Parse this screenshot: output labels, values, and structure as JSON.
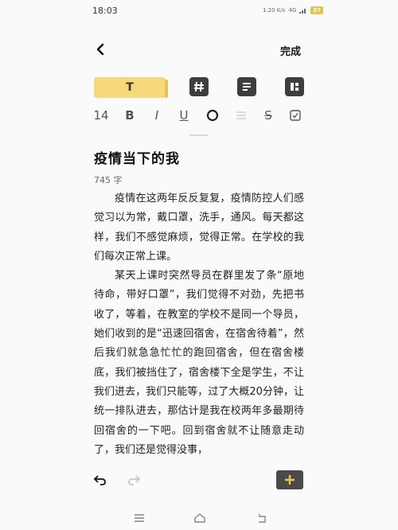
{
  "status": {
    "time": "18:03",
    "speed": "1.20 K/s",
    "network": "4G",
    "battery": "57"
  },
  "header": {
    "done_label": "完成"
  },
  "toolbar": {
    "text_style_label": "T",
    "tools": [
      "hash-icon",
      "list-icon",
      "layout-icon"
    ]
  },
  "format": {
    "font_size": "14",
    "bold": "B",
    "italic": "I",
    "underline": "U",
    "strikethrough": "S"
  },
  "note": {
    "title": "疫情当下的我",
    "word_count": "745 字",
    "paragraphs": [
      "疫情在这两年反反复复，疫情防控人们感觉习以为常，戴口罩，洗手，通风。每天都这样，我们不感觉麻烦，觉得正常。在学校的我们每次正常上课。",
      "某天上课时突然导员在群里发了条“原地待命，带好口罩”，我们觉得不对劲，先把书收了，等着，在教室的学校不是同一个导员，她们收到的是“迅速回宿舍，在宿舍待着”，然后我们就急急忙忙的跑回宿舍，但在宿舍楼底，我们被挡住了，宿舍楼下全是学生，不让我们进去，我们只能等，过了大概20分钟，让统一排队进去，那估计是我在校两年多最期待回宿舍的一下吧。回到宿舍就不让随意走动了，我们还是觉得没事，"
    ]
  },
  "colors": {
    "accent": "#f6d97a",
    "dark_button": "#4a4a4a",
    "plus": "#f0c84a"
  }
}
